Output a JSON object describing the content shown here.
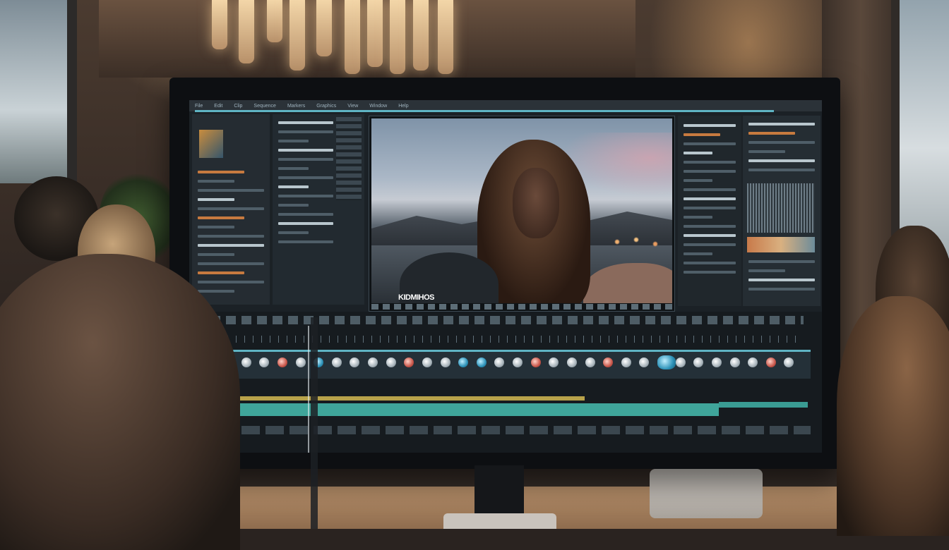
{
  "viewer": {
    "caption": "KIDMIHOS"
  },
  "menubar": {
    "items": [
      "File",
      "Edit",
      "Clip",
      "Sequence",
      "Markers",
      "Graphics",
      "View",
      "Window",
      "Help"
    ]
  },
  "timeline": {
    "clip_colors": [
      "white",
      "white",
      "white",
      "red",
      "white",
      "blue",
      "white",
      "white",
      "white",
      "white",
      "red",
      "white",
      "white",
      "blue",
      "blue",
      "white",
      "white",
      "red",
      "white",
      "white",
      "white",
      "red",
      "white",
      "white",
      "big-blue",
      "white",
      "white",
      "white",
      "white",
      "white",
      "red",
      "white"
    ]
  },
  "colors": {
    "accent": "#5fb4c4",
    "track": "#3fa59a",
    "audio": "#b8a24a"
  }
}
